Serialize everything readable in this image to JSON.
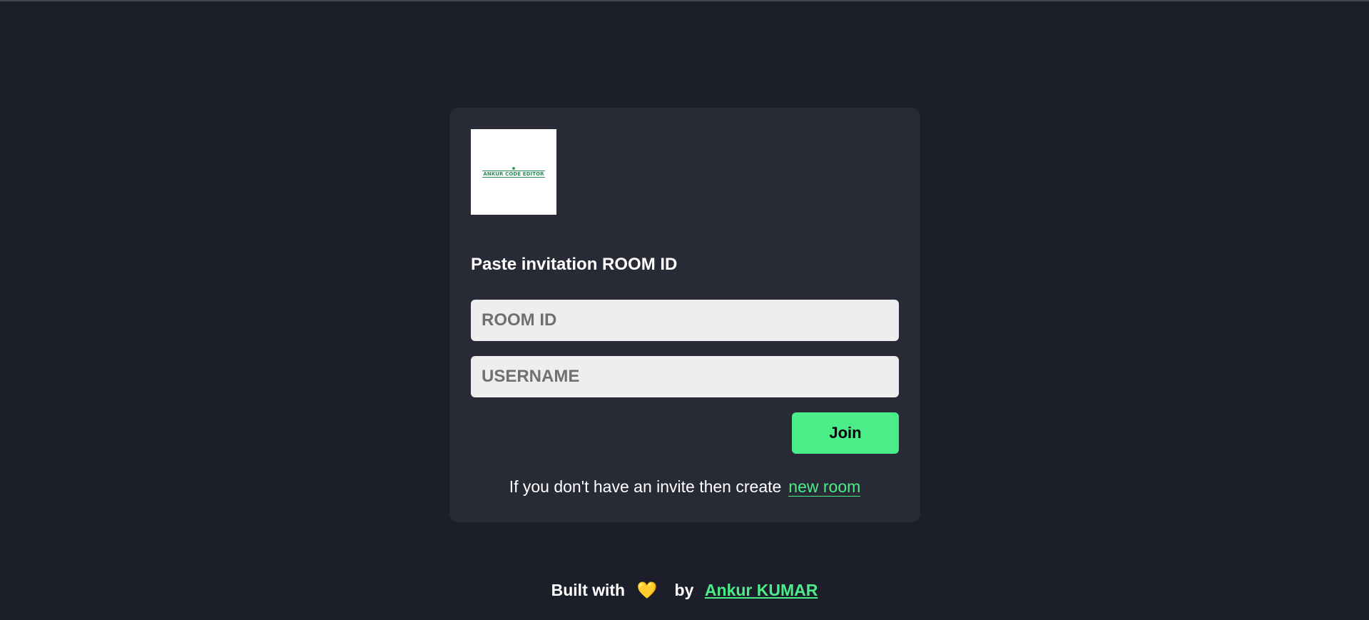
{
  "logo": {
    "text": "ANKUR CODE EDITOR"
  },
  "form": {
    "heading": "Paste invitation ROOM ID",
    "room_id_placeholder": "ROOM ID",
    "room_id_value": "",
    "username_placeholder": "USERNAME",
    "username_value": "",
    "join_label": "Join"
  },
  "info": {
    "text": "If you don't have an invite then create",
    "link_label": "new room"
  },
  "footer": {
    "built_with": "Built with",
    "heart_icon": "💛",
    "by": "by",
    "author": "Ankur KUMAR"
  },
  "colors": {
    "background": "#1c1e29",
    "card": "#282a36",
    "accent": "#4aed88",
    "input_bg": "#eeeeee"
  }
}
